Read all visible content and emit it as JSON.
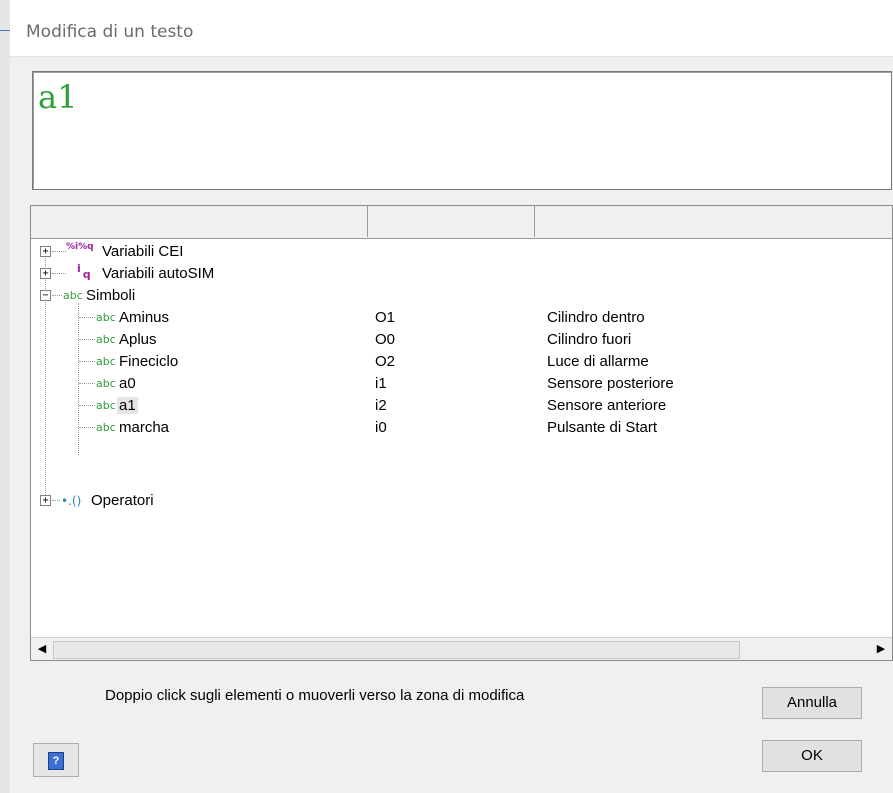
{
  "window": {
    "title": "Modifica di un testo"
  },
  "editor": {
    "value": "a1"
  },
  "tree": {
    "nodes": [
      {
        "label": "Variabili CEI",
        "icon": "percent-iq-variables-icon",
        "expander": "+"
      },
      {
        "label": "Variabili autoSIM",
        "icon": "iq-variables-icon",
        "expander": "+"
      },
      {
        "label": "Simboli",
        "icon": "abc-symbol-icon",
        "expander": "−"
      }
    ],
    "symbols": [
      {
        "name": "Aminus",
        "address": "O1",
        "comment": "Cilindro dentro"
      },
      {
        "name": "Aplus",
        "address": "O0",
        "comment": "Cilindro fuori"
      },
      {
        "name": "Fineciclo",
        "address": "O2",
        "comment": "Luce di allarme"
      },
      {
        "name": "a0",
        "address": "i1",
        "comment": "Sensore posteriore"
      },
      {
        "name": "a1",
        "address": "i2",
        "comment": "Sensore anteriore"
      },
      {
        "name": "marcha",
        "address": "i0",
        "comment": "Pulsante di Start"
      }
    ],
    "operators": {
      "label": "Operatori",
      "icon": "operators-icon",
      "expander": "+"
    },
    "selected": "a1"
  },
  "icons": {
    "cei": "%i%q",
    "autosim_i": "i",
    "autosim_q": "q",
    "abc": "abc",
    "ops": "•.()",
    "scroll_left": "◀",
    "scroll_right": "▶",
    "help": "?"
  },
  "hint": "Doppio click sugli elementi o muoverli verso la zona di modifica",
  "buttons": {
    "cancel": "Annulla",
    "ok": "OK"
  },
  "colors": {
    "editor_text": "#2f9e3a",
    "symbol_icon": "#2f9e3a",
    "var_icon": "#a020a0"
  }
}
